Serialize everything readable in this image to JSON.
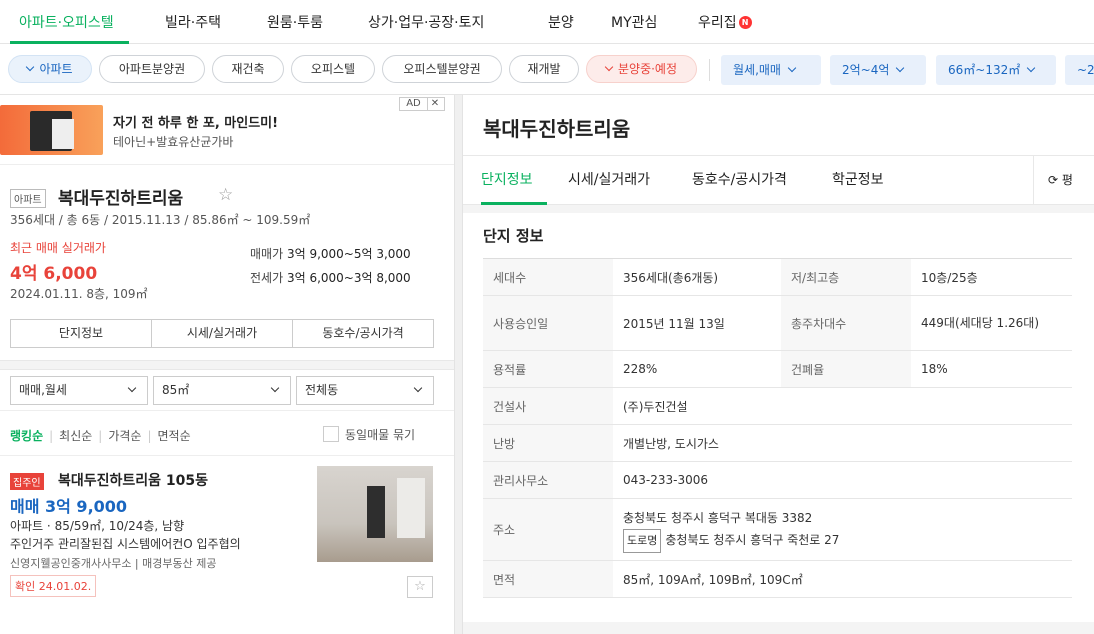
{
  "topnav": {
    "tabs": [
      "아파트·오피스텔",
      "빌라·주택",
      "원룸·투룸",
      "상가·업무·공장·토지",
      "분양",
      "MY관심",
      "우리집"
    ],
    "new_badge": "N"
  },
  "filters": {
    "chips": [
      "아파트",
      "아파트분양권",
      "재건축",
      "오피스텔",
      "오피스텔분양권",
      "재개발",
      "분양중·예정"
    ],
    "dropdowns": [
      "월세,매매",
      "2억~4억",
      "66㎡~132㎡",
      "~2"
    ]
  },
  "ad": {
    "title": "자기 전 하루 한 포, 마인드미!",
    "subtitle": "테아닌+발효유산균가바",
    "badge": "AD",
    "close": "✕"
  },
  "complex": {
    "tag": "아파트",
    "name": "복대두진하트리움",
    "info": "356세대 / 총 6동 / 2015.11.13 / 85.86㎡ ~ 109.59㎡",
    "recent_label": "최근 매매 실거래가",
    "recent_price": "4억 6,000",
    "recent_date": "2024.01.11. 8층, 109㎡",
    "sale_label": "매매가",
    "sale_range": "3억 9,000~5억 3,000",
    "jeonse_label": "전세가",
    "jeonse_range": "3억 6,000~3억 8,000",
    "buttons": [
      "단지정보",
      "시세/실거래가",
      "동호수/공시가격"
    ]
  },
  "selects": [
    "매매,월세",
    "85㎡",
    "전체동"
  ],
  "sort": {
    "options": [
      "랭킹순",
      "최신순",
      "가격순",
      "면적순"
    ],
    "same_listing": "동일매물 묶기"
  },
  "listing": {
    "tag": "집주인",
    "name": "복대두진하트리움 105동",
    "price": "매매 3억 9,000",
    "spec": "아파트 · 85/59㎡, 10/24층, 남향",
    "desc": "주인거주 관리잘된집 시스템에어컨O 입주협의",
    "agent": "신영지웰공인중개사사무소 | 매경부동산 제공",
    "confirm": "확인 24.01.02."
  },
  "detail": {
    "title": "복대두진하트리움",
    "tabs": [
      "단지정보",
      "시세/실거래가",
      "동호수/공시가격",
      "학군정보"
    ],
    "pyeong": "평",
    "section": "단지 정보",
    "rows": [
      [
        "세대수",
        "356세대(총6개동)",
        "저/최고층",
        "10층/25층"
      ],
      [
        "사용승인일",
        "2015년 11월 13일",
        "총주차대수",
        "449대(세대당 1.26대)"
      ],
      [
        "용적률",
        "228%",
        "건폐율",
        "18%"
      ],
      [
        "건설사",
        "(주)두진건설"
      ],
      [
        "난방",
        "개별난방, 도시가스"
      ],
      [
        "관리사무소",
        "043-233-3006"
      ],
      [
        "면적",
        "85㎡, 109A㎡, 109B㎡, 109C㎡"
      ]
    ],
    "address_label": "주소",
    "address": "충청북도 청주시 흥덕구 복대동 3382",
    "road_tag": "도로명",
    "road_address": "충청북도 청주시 흥덕구 죽천로 27"
  }
}
